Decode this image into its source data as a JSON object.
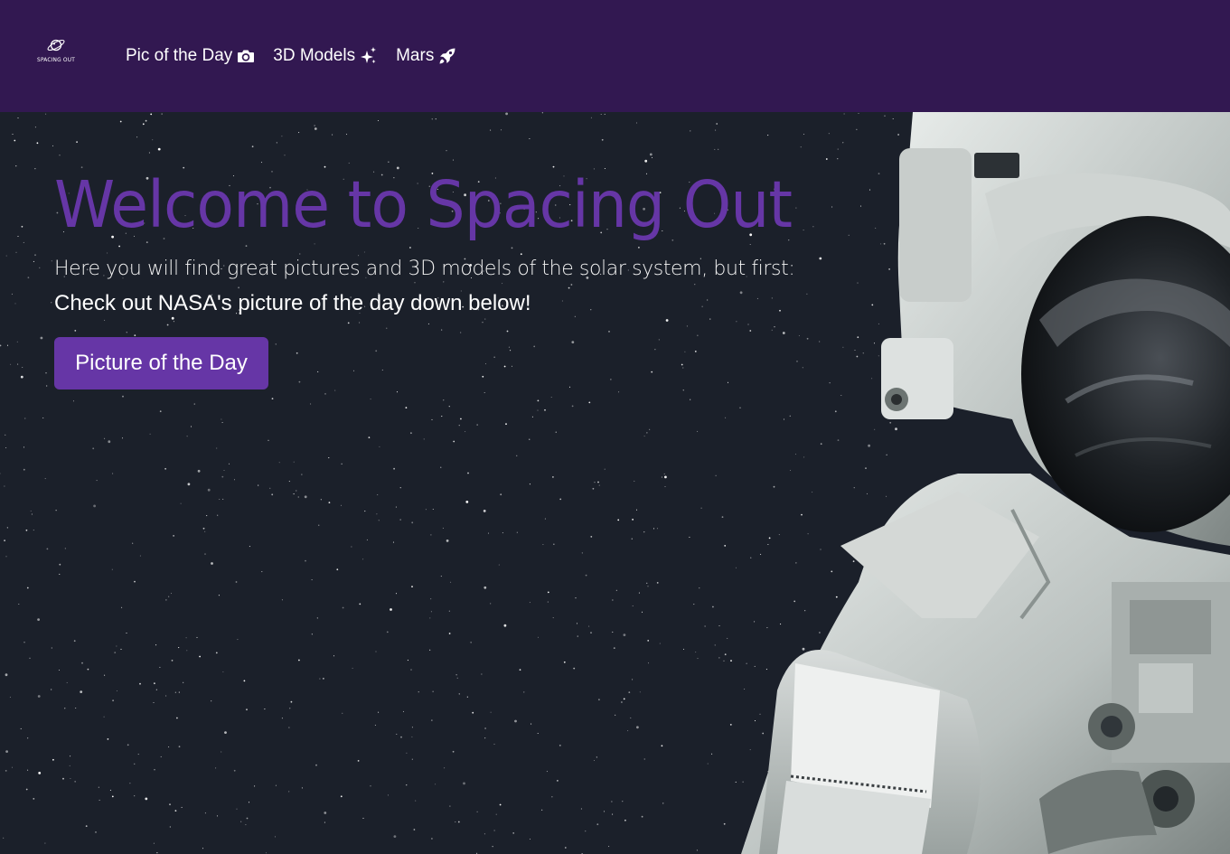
{
  "brand": {
    "name": "SPACING OUT",
    "icon": "planet-ring-icon"
  },
  "nav": {
    "items": [
      {
        "label": "Pic of the Day",
        "icon": "camera-icon"
      },
      {
        "label": "3D Models",
        "icon": "sparkles-icon"
      },
      {
        "label": "Mars",
        "icon": "rocket-icon"
      }
    ]
  },
  "hero": {
    "title": "Welcome to Spacing Out",
    "subtitle": "Here you will find great pictures and 3D models of the solar system, but first:",
    "cta_text": "Check out NASA's picture of the day down below!",
    "button_label": "Picture of the Day"
  },
  "colors": {
    "navbar_bg": "#321851",
    "accent": "#6636a6",
    "hero_bg": "#1b202a",
    "text": "#ffffff"
  }
}
